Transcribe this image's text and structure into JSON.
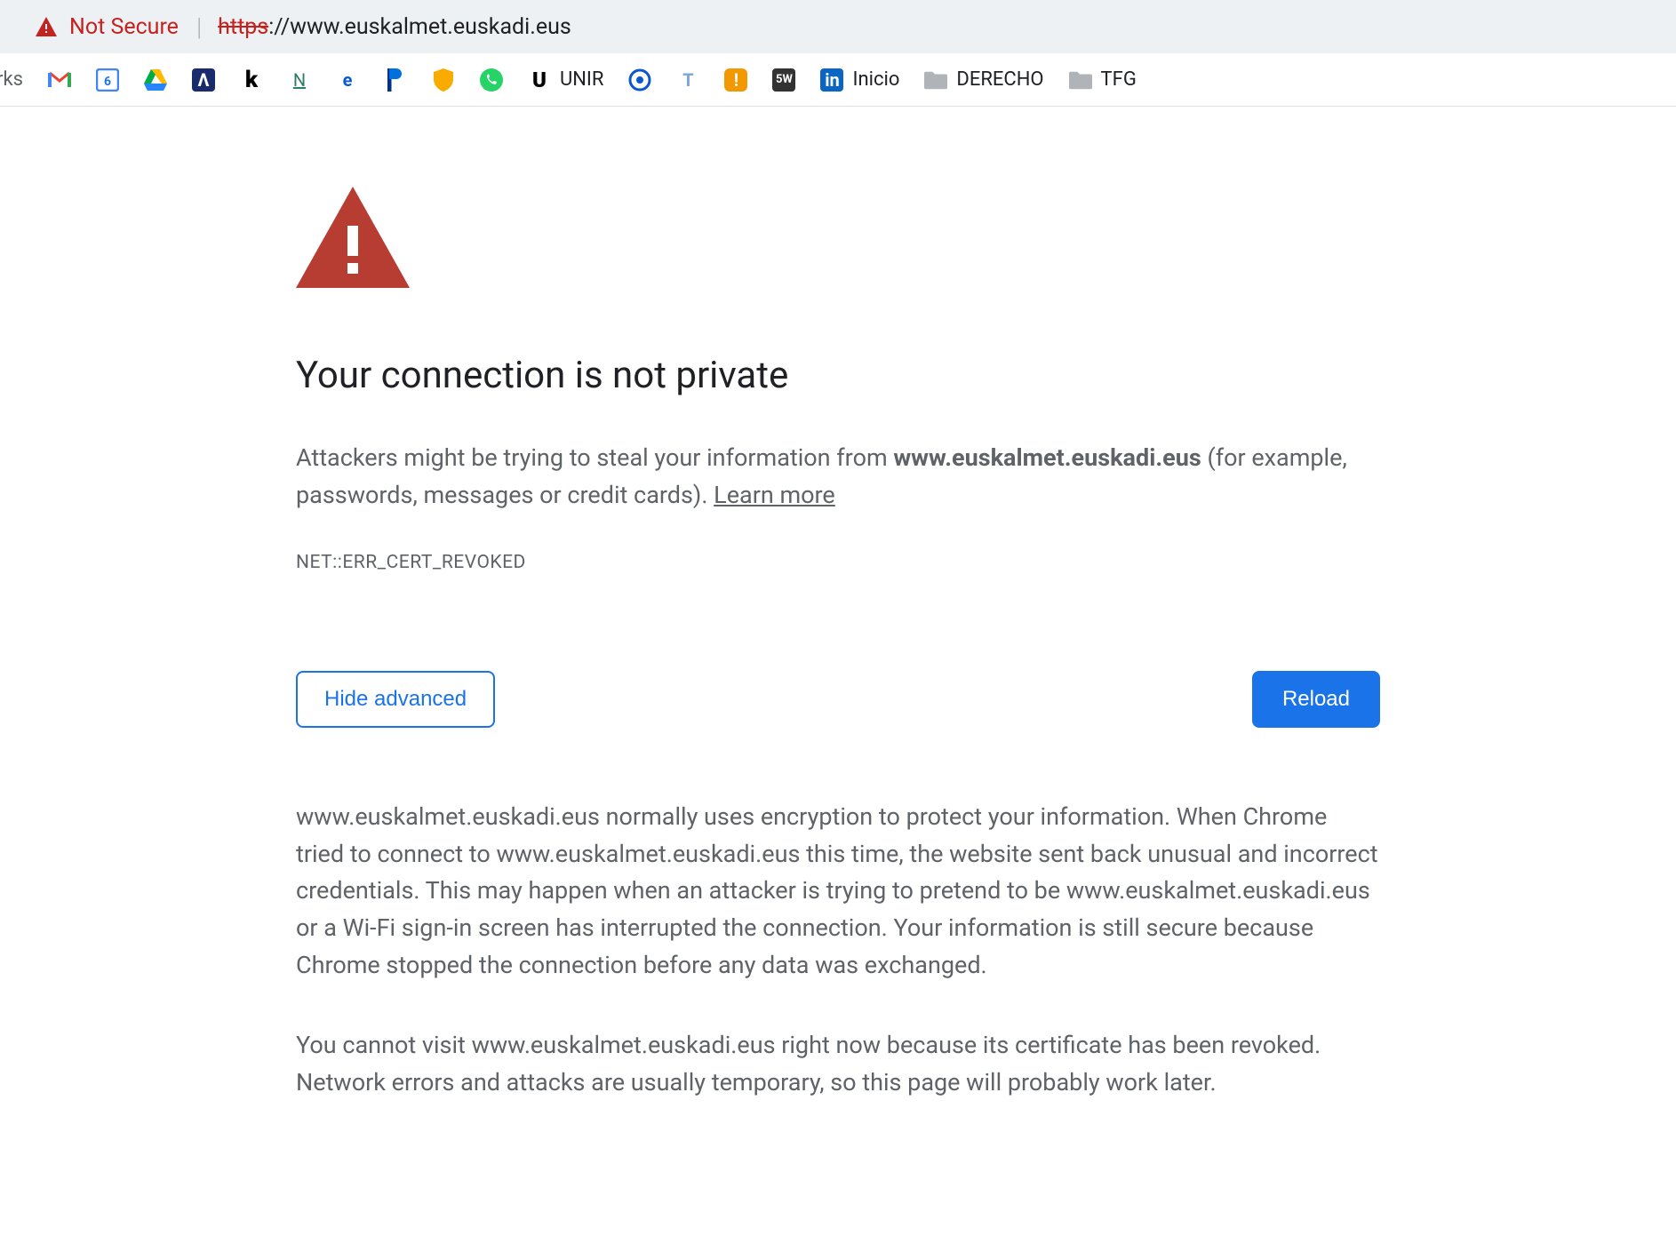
{
  "address_bar": {
    "not_secure_label": "Not Secure",
    "url_scheme": "https",
    "url_rest": "://www.euskalmet.euskadi.eus"
  },
  "bookmarks": {
    "leading_cut": "rks",
    "items": [
      {
        "name": "gmail-icon",
        "label": ""
      },
      {
        "name": "calendar-icon",
        "label": ""
      },
      {
        "name": "drive-icon",
        "label": ""
      },
      {
        "name": "bookmark-a",
        "label": ""
      },
      {
        "name": "bookmark-k",
        "label": ""
      },
      {
        "name": "bookmark-n",
        "label": ""
      },
      {
        "name": "bookmark-e",
        "label": ""
      },
      {
        "name": "bookmark-p",
        "label": ""
      },
      {
        "name": "bookmark-shield",
        "label": ""
      },
      {
        "name": "whatsapp-icon",
        "label": ""
      },
      {
        "name": "bookmark-u",
        "label": "UNIR"
      },
      {
        "name": "bookmark-target",
        "label": ""
      },
      {
        "name": "bookmark-t",
        "label": ""
      },
      {
        "name": "bookmark-chat",
        "label": ""
      },
      {
        "name": "bookmark-5w",
        "label": ""
      },
      {
        "name": "linkedin-icon",
        "label": "Inicio"
      }
    ],
    "folders": [
      {
        "name": "folder-derecho",
        "label": "DERECHO"
      },
      {
        "name": "folder-tfg",
        "label": "TFG"
      }
    ]
  },
  "interstitial": {
    "headline": "Your connection is not private",
    "para1_pre": "Attackers might be trying to steal your information from ",
    "para1_domain": "www.euskalmet.euskadi.eus",
    "para1_post": " (for example, passwords, messages or credit cards). ",
    "learn_more": "Learn more",
    "error_code": "NET::ERR_CERT_REVOKED",
    "btn_advanced": "Hide advanced",
    "btn_reload": "Reload",
    "para2": "www.euskalmet.euskadi.eus normally uses encryption to protect your information. When Chrome tried to connect to www.euskalmet.euskadi.eus this time, the website sent back unusual and incorrect credentials. This may happen when an attacker is trying to pretend to be www.euskalmet.euskadi.eus or a Wi-Fi sign-in screen has interrupted the connection. Your information is still secure because Chrome stopped the connection before any data was exchanged.",
    "para3": "You cannot visit www.euskalmet.euskadi.eus right now because its certificate has been revoked. Network errors and attacks are usually temporary, so this page will probably work later."
  }
}
